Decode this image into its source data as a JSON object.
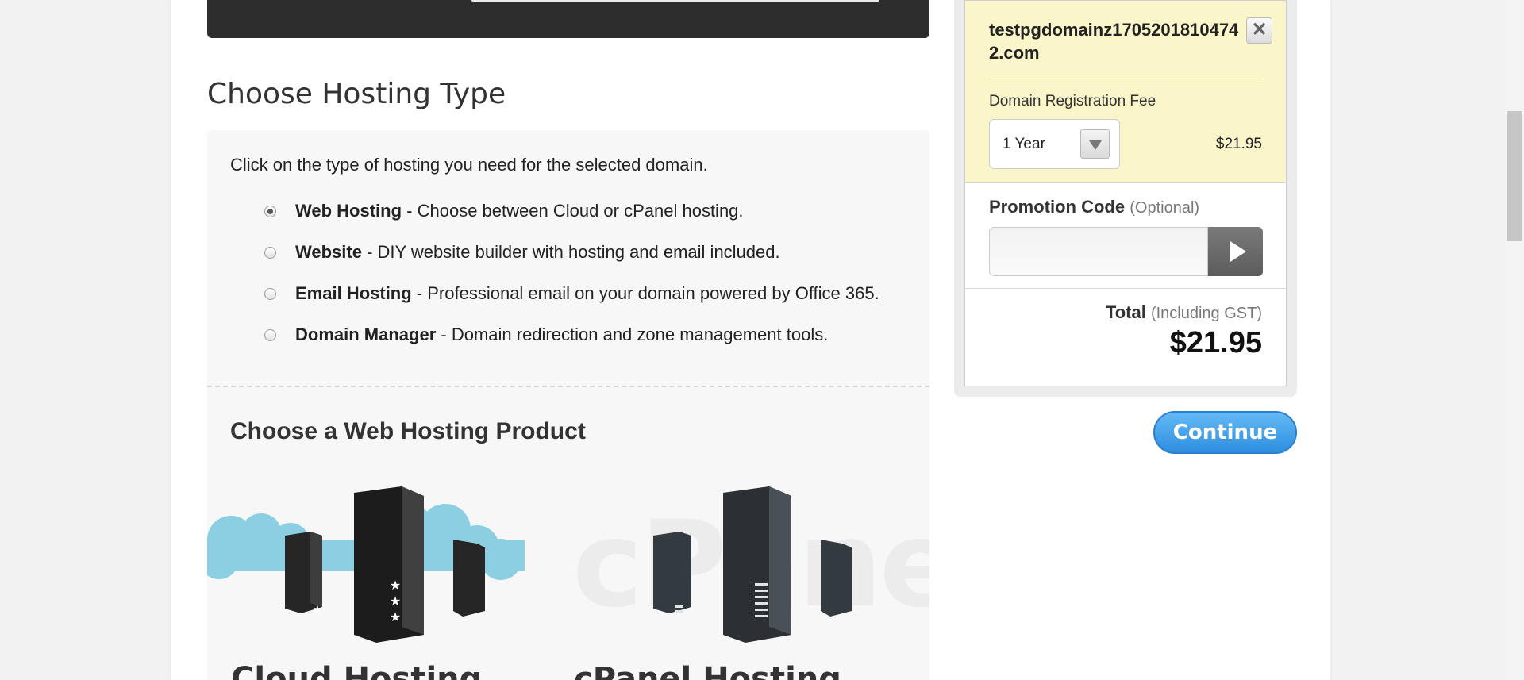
{
  "hosting_type": {
    "title": "Choose Hosting Type",
    "intro": "Click on the type of hosting you need for the selected domain.",
    "options": [
      {
        "name": "Web Hosting",
        "desc": "- Choose between Cloud or cPanel hosting.",
        "selected": true
      },
      {
        "name": "Website",
        "desc": "- DIY website builder with hosting and email included.",
        "selected": false
      },
      {
        "name": "Email Hosting",
        "desc": "- Professional email on your domain powered by Office 365.",
        "selected": false
      },
      {
        "name": "Domain Manager",
        "desc": "- Domain redirection and zone management tools.",
        "selected": false
      }
    ]
  },
  "products": {
    "title": "Choose a Web Hosting Product",
    "watermark": "cPanel",
    "items": [
      {
        "name": "Cloud Hosting"
      },
      {
        "name": "cPanel Hosting"
      }
    ]
  },
  "cart": {
    "domain": "testpgdomainz1705201810474 2.com",
    "remove_icon": "close-icon",
    "remove_symbol": "✕",
    "fee_label": "Domain Registration Fee",
    "period": "1 Year",
    "fee_price": "$21.95",
    "promo_label": "Promotion Code",
    "promo_optional": "(Optional)",
    "promo_value": "",
    "total_label": "Total",
    "total_note": "(Including GST)",
    "total_value": "$21.95"
  },
  "continue_label": "Continue"
}
